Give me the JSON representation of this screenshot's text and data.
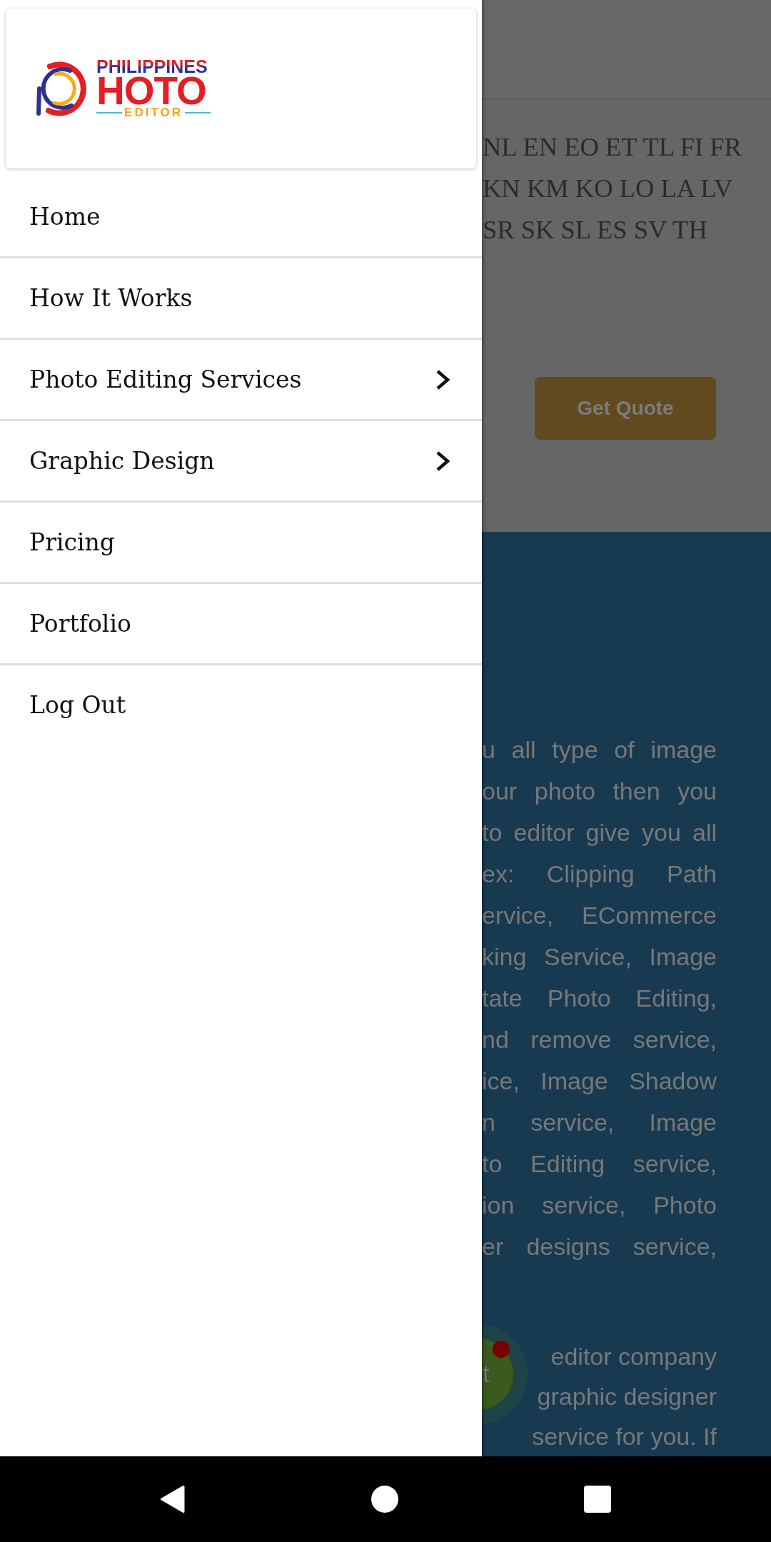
{
  "drawer": {
    "logo": {
      "tagline_top": "PHILIPPINES",
      "wordmark": "HOTO",
      "tagline_bottom": "EDITOR"
    },
    "menu_items": [
      {
        "label": "Home",
        "submenu": false
      },
      {
        "label": "How It Works",
        "submenu": false
      },
      {
        "label": "Photo Editing Services",
        "submenu": true
      },
      {
        "label": "Graphic Design",
        "submenu": true
      },
      {
        "label": "Pricing",
        "submenu": false
      },
      {
        "label": "Portfolio",
        "submenu": false
      },
      {
        "label": "Log Out",
        "submenu": false
      }
    ]
  },
  "page": {
    "language_codes": [
      "NL EN EO ET TL FI FR",
      "KN KM KO LO LA LV",
      "SR SK SL ES SV TH"
    ],
    "quote_button": "Get Quote",
    "paragraphs": [
      {
        "lines": [
          "u all type of image",
          "our photo then you",
          "to editor give you all",
          "ex: Clipping Path",
          "ervice, ECommerce",
          "king Service, Image",
          "tate Photo Editing,",
          "nd remove service,",
          "ice, Image Shadow",
          "n service, Image",
          "to Editing service,",
          "ion service, Photo",
          "er designs service,"
        ]
      },
      {
        "lines": [
          "editor company",
          "graphic designer",
          "service for you. If"
        ]
      }
    ],
    "chat_button": {
      "label": "t",
      "notification": true
    }
  }
}
